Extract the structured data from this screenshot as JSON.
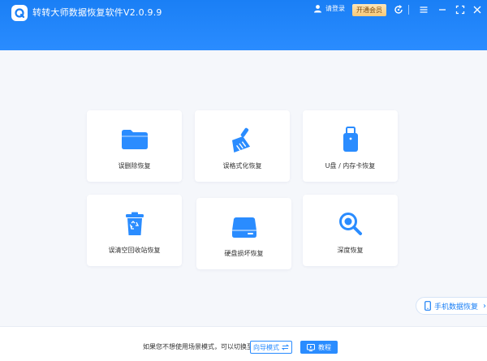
{
  "app": {
    "title": "转转大师数据恢复软件V2.0.9.9"
  },
  "header": {
    "login_label": "请登录",
    "vip_label": "开通会员"
  },
  "cards": [
    {
      "label": "误删除恢复",
      "icon": "folder-icon"
    },
    {
      "label": "误格式化恢复",
      "icon": "broom-icon"
    },
    {
      "label": "U盘 / 内存卡恢复",
      "icon": "usb-drive-icon"
    },
    {
      "label": "误清空回收站恢复",
      "icon": "recycle-bin-icon"
    },
    {
      "label": "硬盘损坏恢复",
      "icon": "hard-disk-icon"
    },
    {
      "label": "深度恢复",
      "icon": "deep-search-icon"
    }
  ],
  "mobile_recovery": {
    "label": "手机数据恢复"
  },
  "footer": {
    "prompt": "如果您不想使用场景模式，可以切换至",
    "wizard_label": "向导模式",
    "tutorial_label": "教程"
  },
  "colors": {
    "brand": "#1a7ff5",
    "card_icon": "#2a8cff",
    "vip_gold": "#f7c978"
  }
}
